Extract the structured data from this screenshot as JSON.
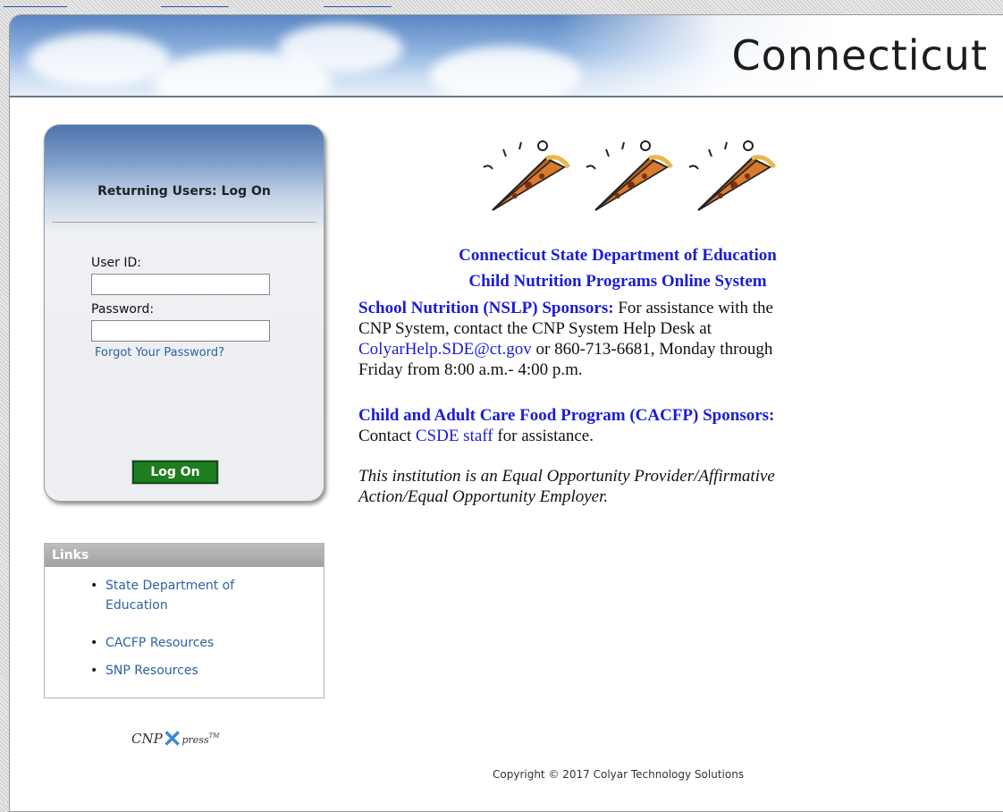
{
  "banner": {
    "title": "Connecticut"
  },
  "login": {
    "heading": "Returning Users: Log On",
    "user_id_label": "User ID:",
    "user_id_value": "",
    "password_label": "Password:",
    "password_value": "",
    "forgot_link": "Forgot Your Password?",
    "logon_button": "Log On"
  },
  "links": {
    "header": "Links",
    "items": [
      {
        "line1": "State Department of",
        "line2": "Education"
      },
      {
        "line1": "CACFP Resources"
      },
      {
        "line1": "SNP Resources"
      }
    ]
  },
  "logo": {
    "cnp": "CNP",
    "xpress": "press",
    "tm": "TM"
  },
  "main": {
    "title1": "Connecticut State Department of Education",
    "title2": "Child Nutrition Programs Online System",
    "nslp": {
      "header": "School Nutrition (NSLP) Sponsors:",
      "line1_rest": " For assistance with the",
      "line2": "CNP System, contact the CNP System Help Desk at",
      "email": "ColyarHelp.SDE@ct.gov",
      "line3_rest": " or 860-713-6681, Monday through",
      "line4": "Friday from 8:00 a.m.- 4:00 p.m."
    },
    "cacfp": {
      "header": "Child and Adult Care Food Program (CACFP) Sponsors:",
      "contact_prefix": "Contact ",
      "staff_link": "CSDE staff",
      "contact_suffix": " for assistance."
    },
    "eeo_line1": " This institution is an Equal Opportunity Provider/Affirmative",
    "eeo_line2": "Action/Equal Opportunity Employer."
  },
  "footer": {
    "copyright": "Copyright © 2017 Colyar Technology Solutions"
  },
  "colors": {
    "title_blue": "#1c1cd6",
    "link_blue": "#2f62a0",
    "button_green": "#1e7d1e"
  }
}
